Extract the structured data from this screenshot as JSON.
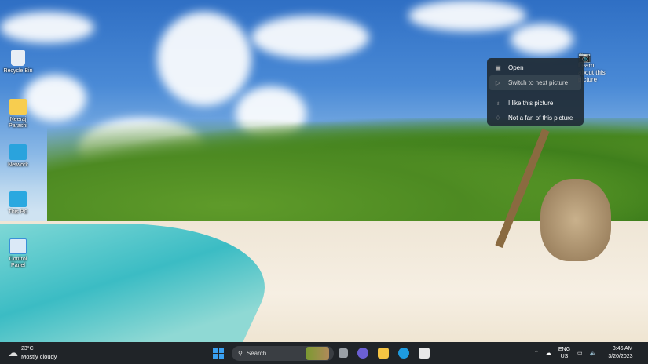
{
  "desktop": {
    "icons": [
      {
        "label": "Recycle Bin",
        "icon": "recycle-bin-icon"
      },
      {
        "label": "Neeraj Parashi",
        "icon": "folder-icon"
      },
      {
        "label": "Network",
        "icon": "network-icon"
      },
      {
        "label": "This PC",
        "icon": "monitor-icon"
      },
      {
        "label": "Control Panel",
        "icon": "control-panel-icon"
      }
    ]
  },
  "spotlight": {
    "learn_label": "Learn about this picture"
  },
  "context_menu": {
    "items": [
      {
        "label": "Open",
        "icon": "open-icon"
      },
      {
        "label": "Switch to next picture",
        "icon": "next-icon"
      },
      {
        "label": "I like this picture",
        "icon": "thumbs-up-icon"
      },
      {
        "label": "Not a fan of this picture",
        "icon": "thumbs-down-icon"
      }
    ]
  },
  "taskbar": {
    "weather": {
      "temp": "23°C",
      "condition": "Mostly cloudy"
    },
    "search_placeholder": "Search",
    "lang": {
      "line1": "ENG",
      "line2": "US"
    },
    "time": "3:46 AM",
    "date": "3/20/2023",
    "colors": {
      "start": "#3aa0f0",
      "edge": "#1e9be0"
    }
  }
}
